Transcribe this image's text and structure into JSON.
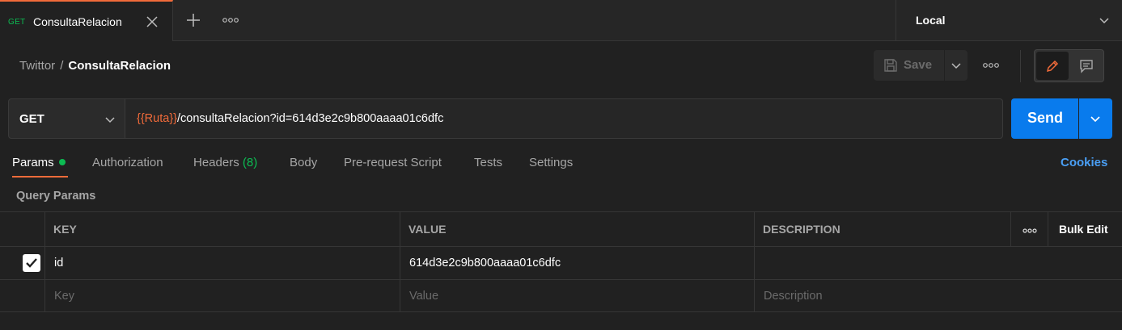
{
  "tab": {
    "method": "GET",
    "name": "ConsultaRelacion"
  },
  "environment": {
    "selected": "Local"
  },
  "breadcrumb": {
    "parent": "Twittor",
    "separator": "/",
    "current": "ConsultaRelacion"
  },
  "toolbar": {
    "save_label": "Save"
  },
  "request": {
    "method": "GET",
    "url_variable": "{{Ruta}}",
    "url_path": "/consultaRelacion?id=614d3e2c9b800aaaa01c6dfc",
    "send_label": "Send"
  },
  "request_tabs": {
    "params": "Params",
    "authorization": "Authorization",
    "headers": "Headers",
    "headers_count": "(8)",
    "body": "Body",
    "prerequest": "Pre-request Script",
    "tests": "Tests",
    "settings": "Settings",
    "cookies": "Cookies"
  },
  "params": {
    "section_title": "Query Params",
    "columns": {
      "key": "KEY",
      "value": "VALUE",
      "description": "DESCRIPTION",
      "bulk_edit": "Bulk Edit"
    },
    "rows": [
      {
        "checked": true,
        "key": "id",
        "value": "614d3e2c9b800aaaa01c6dfc",
        "description": ""
      }
    ],
    "placeholder": {
      "key": "Key",
      "value": "Value",
      "description": "Description"
    }
  },
  "colors": {
    "accent": "#f26b3a",
    "send": "#097bed",
    "get_method": "#0cbb52",
    "link": "#4a9ff5"
  }
}
